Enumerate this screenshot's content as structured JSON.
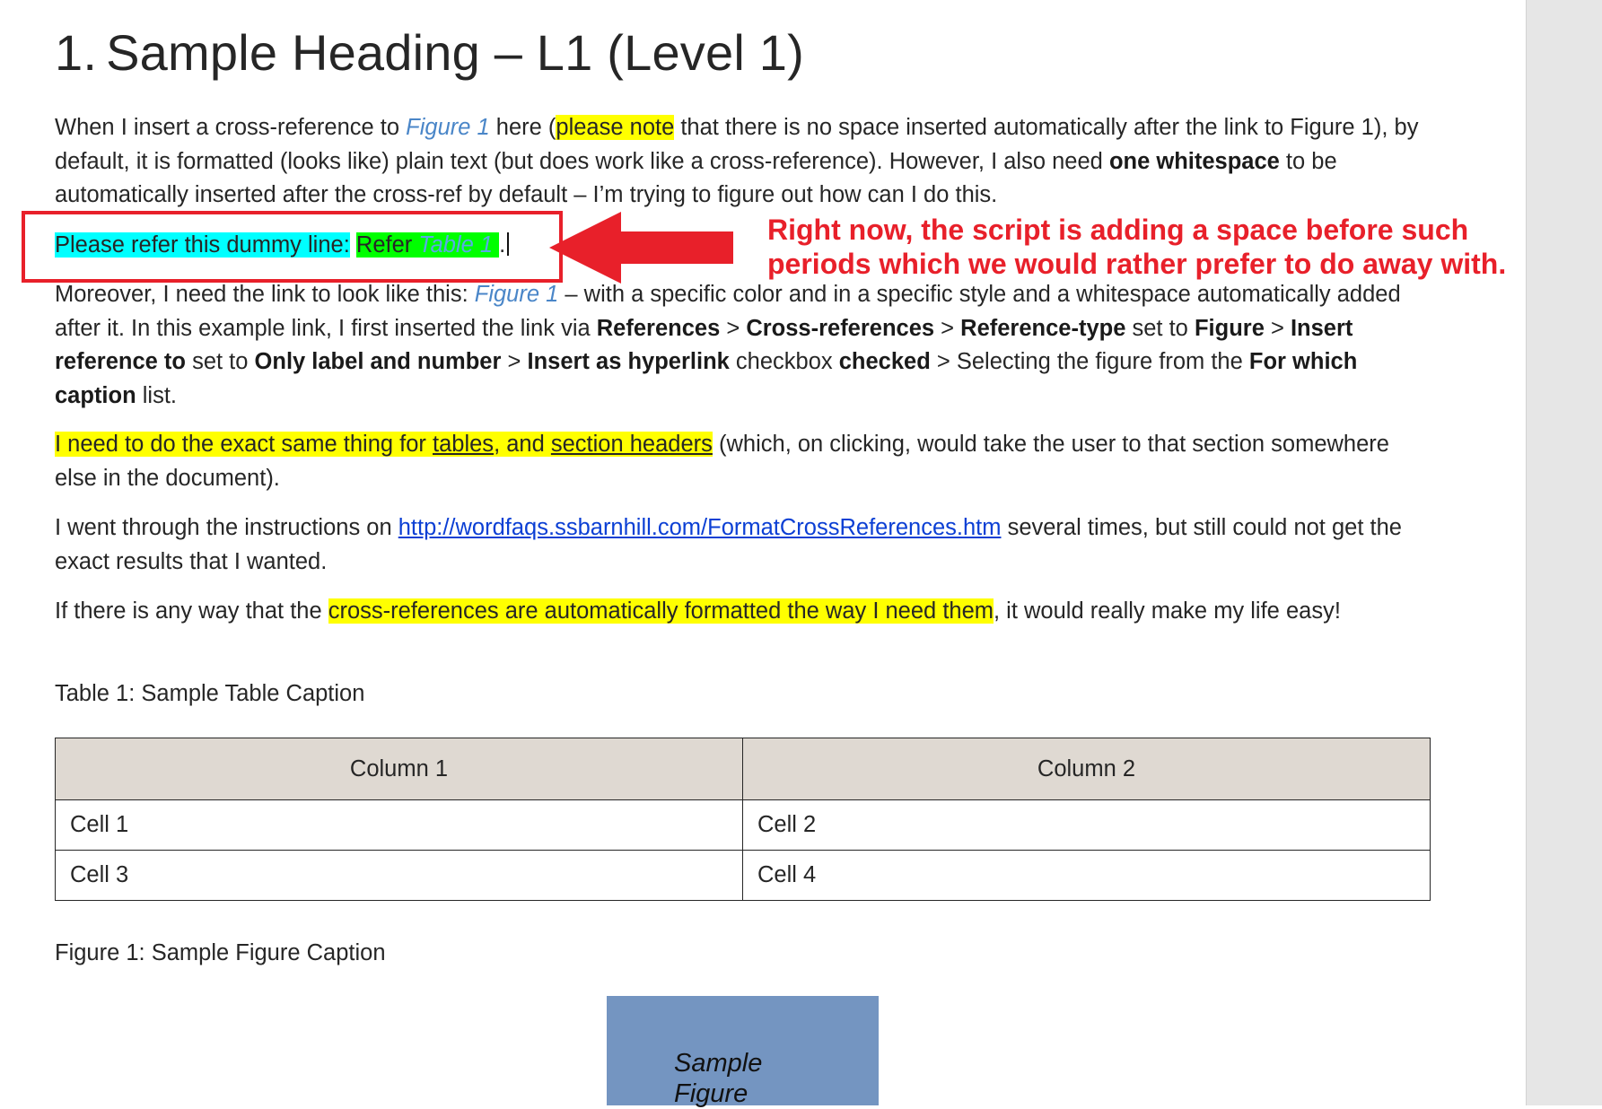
{
  "heading": {
    "number": "1.",
    "text": "Sample Heading – L1 (Level 1)"
  },
  "p1": {
    "t1": "When I insert a cross-reference to ",
    "xref": "Figure 1",
    "t2": " here (",
    "hl": "please note",
    "t3": " that there is no space inserted automatically after the link to Figure 1), by default, it is formatted (looks like) plain text (but does work like a cross-reference). However, I also need ",
    "b1": "one whitespace",
    "t4": " to be automatically inserted after the cross-ref by default – I’m trying to figure out how can I do this."
  },
  "dummy": {
    "cyan": "Please refer this dummy line:",
    "space": " ",
    "green_text": "Refer ",
    "green_xref": "Table 1 ",
    "period": "."
  },
  "annotation": {
    "line1": "Right now, the script is adding a space before such",
    "line2": "periods which we would rather prefer to do away with.",
    "color": "#e8202a"
  },
  "p2": {
    "t1": "Moreover, I need the link to look like this: ",
    "xref": "Figure 1",
    "t2": "  – with a specific color and in a specific style and a whitespace automatically added after it. In this example link, I first inserted the link via ",
    "b1": "References",
    "t3": " > ",
    "b2": "Cross-references",
    "t4": " > ",
    "b3": "Reference-type",
    "t5": " set to ",
    "b4": "Figure",
    "t6": " > ",
    "b5": "Insert reference to",
    "t7": " set to ",
    "b6": "Only label and number",
    "t8": " > ",
    "b7": "Insert as hyperlink",
    "t9": " checkbox ",
    "b8": "checked",
    "t10": " > Selecting the figure from the ",
    "b9": "For which caption",
    "t11": " list."
  },
  "p3": {
    "h1": "I need to do the exact same thing for ",
    "u1": "tables",
    "h2": ", and ",
    "u2": "section headers",
    "t1": " (which, on clicking, would take the user to that section somewhere else in the document)."
  },
  "p4": {
    "t1": "I went through the instructions on ",
    "link": "http://wordfaqs.ssbarnhill.com/FormatCrossReferences.htm",
    "t2": " several times, but still could not get the exact results that I wanted."
  },
  "p5": {
    "t1": "If there is any way that the ",
    "hl": "cross-references are automatically formatted the way I need them",
    "t2": ", it would really make my life easy!"
  },
  "table_caption": "Table 1: Sample Table Caption",
  "table": {
    "headers": [
      "Column 1",
      "Column 2"
    ],
    "rows": [
      [
        "Cell 1",
        "Cell 2"
      ],
      [
        "Cell 3",
        "Cell 4"
      ]
    ]
  },
  "figure_caption": "Figure 1: Sample Figure Caption",
  "figure": {
    "label_line1": "Sample",
    "label_line2": "Figure",
    "color": "#7495c1"
  }
}
